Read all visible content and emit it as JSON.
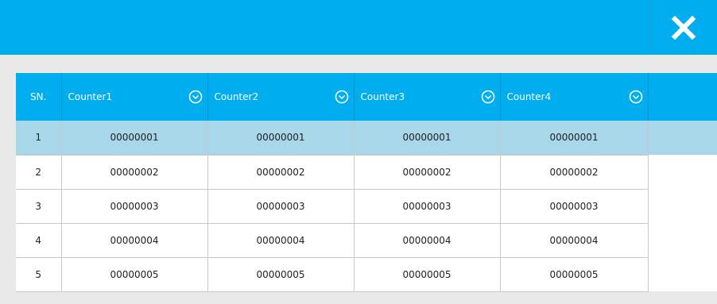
{
  "window": {
    "accent_color": "#00aeef",
    "close_icon": "close-icon"
  },
  "table": {
    "headers": {
      "sn": "SN.",
      "columns": [
        "Counter1",
        "Counter2",
        "Counter3",
        "Counter4"
      ]
    },
    "rows": [
      {
        "sn": "1",
        "values": [
          "00000001",
          "00000001",
          "00000001",
          "00000001"
        ],
        "selected": true
      },
      {
        "sn": "2",
        "values": [
          "00000002",
          "00000002",
          "00000002",
          "00000002"
        ],
        "selected": false
      },
      {
        "sn": "3",
        "values": [
          "00000003",
          "00000003",
          "00000003",
          "00000003"
        ],
        "selected": false
      },
      {
        "sn": "4",
        "values": [
          "00000004",
          "00000004",
          "00000004",
          "00000004"
        ],
        "selected": false
      },
      {
        "sn": "5",
        "values": [
          "00000005",
          "00000005",
          "00000005",
          "00000005"
        ],
        "selected": false
      }
    ]
  }
}
